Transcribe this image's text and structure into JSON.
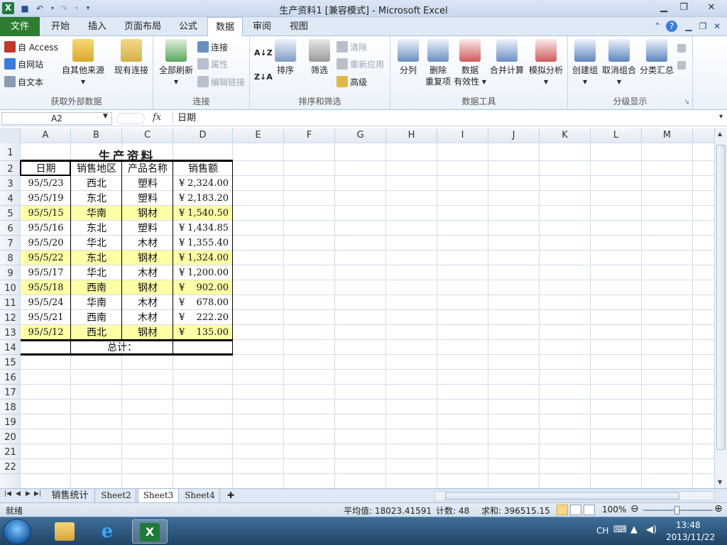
{
  "window": {
    "title": "生产资料1  [兼容模式]  -  Microsoft Excel",
    "logo": "X",
    "qat_icons": [
      "save-icon",
      "undo-icon",
      "redo-icon",
      "customize-icon"
    ],
    "controls": [
      "minimize-icon",
      "maximize-icon",
      "close-icon"
    ]
  },
  "tabs": {
    "file": "文件",
    "items": [
      "开始",
      "插入",
      "页面布局",
      "公式",
      "数据",
      "审阅",
      "视图"
    ],
    "active": "数据"
  },
  "ribbon": {
    "external": {
      "label": "获取外部数据",
      "access": "自 Access",
      "web": "自网站",
      "text": "自文本",
      "other": "自其他来源",
      "existing": "现有连接"
    },
    "connections": {
      "label": "连接",
      "refresh_all": "全部刷新",
      "connections": "连接",
      "properties": "属性",
      "edit_links": "编辑链接"
    },
    "sort_filter": {
      "label": "排序和筛选",
      "sort": "排序",
      "filter": "筛选",
      "clear": "清除",
      "reapply": "重新应用",
      "advanced": "高级"
    },
    "data_tools": {
      "label": "数据工具",
      "text_to_columns": "分列",
      "remove_dup_1": "删除",
      "remove_dup_2": "重复项",
      "validation_1": "数据",
      "validation_2": "有效性",
      "consolidate": "合并计算",
      "what_if": "模拟分析"
    },
    "outline": {
      "label": "分级显示",
      "group": "创建组",
      "ungroup": "取消组合",
      "subtotal": "分类汇总"
    }
  },
  "formula_bar": {
    "name_box": "A2",
    "fx": "fx",
    "value": "日期"
  },
  "columns": [
    "A",
    "B",
    "C",
    "D",
    "E",
    "F",
    "G",
    "H",
    "I",
    "J",
    "K",
    "L",
    "M"
  ],
  "rows": [
    "1",
    "2",
    "3",
    "4",
    "5",
    "6",
    "7",
    "8",
    "9",
    "10",
    "11",
    "12",
    "13",
    "14",
    "15",
    "16",
    "17",
    "18",
    "19",
    "20",
    "21",
    "22"
  ],
  "sheet": {
    "title": "生产资料",
    "headers": [
      "日期",
      "销售地区",
      "产品名称",
      "销售额"
    ],
    "data": [
      {
        "date": "95/5/23",
        "region": "西北",
        "product": "塑料",
        "currency": "¥",
        "amount": "2,324.00",
        "highlight": false
      },
      {
        "date": "95/5/19",
        "region": "东北",
        "product": "塑料",
        "currency": "¥",
        "amount": "2,183.20",
        "highlight": false
      },
      {
        "date": "95/5/15",
        "region": "华南",
        "product": "钢材",
        "currency": "¥",
        "amount": "1,540.50",
        "highlight": true
      },
      {
        "date": "95/5/16",
        "region": "东北",
        "product": "塑料",
        "currency": "¥",
        "amount": "1,434.85",
        "highlight": false
      },
      {
        "date": "95/5/20",
        "region": "华北",
        "product": "木材",
        "currency": "¥",
        "amount": "1,355.40",
        "highlight": false
      },
      {
        "date": "95/5/22",
        "region": "东北",
        "product": "钢材",
        "currency": "¥",
        "amount": "1,324.00",
        "highlight": true
      },
      {
        "date": "95/5/17",
        "region": "华北",
        "product": "木材",
        "currency": "¥",
        "amount": "1,200.00",
        "highlight": false
      },
      {
        "date": "95/5/18",
        "region": "西南",
        "product": "钢材",
        "currency": "¥",
        "amount": "902.00",
        "highlight": true
      },
      {
        "date": "95/5/24",
        "region": "华南",
        "product": "木材",
        "currency": "¥",
        "amount": "678.00",
        "highlight": false
      },
      {
        "date": "95/5/21",
        "region": "西南",
        "product": "木材",
        "currency": "¥",
        "amount": "222.20",
        "highlight": false
      },
      {
        "date": "95/5/12",
        "region": "西北",
        "product": "钢材",
        "currency": "¥",
        "amount": "135.00",
        "highlight": true
      }
    ],
    "total_label": "总计："
  },
  "sheet_tabs": {
    "items": [
      "销售统计",
      "Sheet2",
      "Sheet3",
      "Sheet4"
    ],
    "active": "Sheet3"
  },
  "status": {
    "ready": "就绪",
    "average": "平均值: 18023.41591",
    "count": "计数: 48",
    "sum": "求和: 396515.15",
    "zoom": "100%"
  },
  "taskbar": {
    "ime": "CH",
    "time": "13:48",
    "date": "2013/11/22"
  },
  "colors": {
    "highlight": "#ffffa6",
    "file_tab": "#2f7d31",
    "excel_green": "#1f7a3a"
  }
}
